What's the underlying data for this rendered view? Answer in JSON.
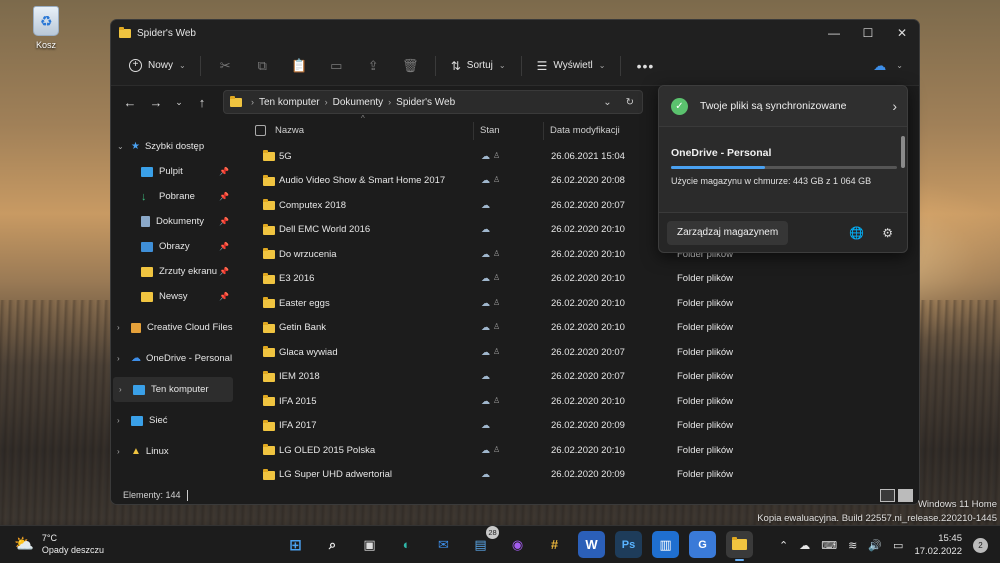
{
  "desktop": {
    "recycle_bin_label": "Kosz"
  },
  "window": {
    "title": "Spider's Web",
    "controls": {
      "minimize": "—",
      "maximize": "☐",
      "close": "✕"
    }
  },
  "toolbar": {
    "new_label": "Nowy",
    "sort_label": "Sortuj",
    "view_label": "Wyświetl",
    "more_label": "•••"
  },
  "address": {
    "crumbs": [
      "Ten komputer",
      "Dokumenty",
      "Spider's Web"
    ]
  },
  "sidebar": {
    "quick_access": "Szybki dostęp",
    "pinned": [
      "Pulpit",
      "Pobrane",
      "Dokumenty",
      "Obrazy",
      "Zrzuty ekranu",
      "Newsy"
    ],
    "creative_cloud": "Creative Cloud Files",
    "onedrive": "OneDrive - Personal",
    "this_pc": "Ten komputer",
    "network": "Sieć",
    "linux": "Linux"
  },
  "columns": {
    "name": "Nazwa",
    "status": "Stan",
    "date": "Data modyfikacji"
  },
  "files": [
    {
      "name": "5G",
      "date": "26.06.2021 15:04",
      "type": "",
      "shared": true
    },
    {
      "name": "Audio Video Show & Smart Home 2017",
      "date": "26.02.2020 20:08",
      "type": "",
      "shared": true
    },
    {
      "name": "Computex 2018",
      "date": "26.02.2020 20:07",
      "type": "",
      "shared": false
    },
    {
      "name": "Dell EMC World 2016",
      "date": "26.02.2020 20:10",
      "type": "",
      "shared": false
    },
    {
      "name": "Do wrzucenia",
      "date": "26.02.2020 20:10",
      "type": "Folder plików",
      "shared": true
    },
    {
      "name": "E3 2016",
      "date": "26.02.2020 20:10",
      "type": "Folder plików",
      "shared": true
    },
    {
      "name": "Easter eggs",
      "date": "26.02.2020 20:10",
      "type": "Folder plików",
      "shared": true
    },
    {
      "name": "Getin Bank",
      "date": "26.02.2020 20:10",
      "type": "Folder plików",
      "shared": true
    },
    {
      "name": "Glaca wywiad",
      "date": "26.02.2020 20:07",
      "type": "Folder plików",
      "shared": true
    },
    {
      "name": "IEM 2018",
      "date": "26.02.2020 20:07",
      "type": "Folder plików",
      "shared": false
    },
    {
      "name": "IFA 2015",
      "date": "26.02.2020 20:10",
      "type": "Folder plików",
      "shared": true
    },
    {
      "name": "IFA 2017",
      "date": "26.02.2020 20:09",
      "type": "Folder plików",
      "shared": false
    },
    {
      "name": "LG OLED 2015 Polska",
      "date": "26.02.2020 20:10",
      "type": "Folder plików",
      "shared": true
    },
    {
      "name": "LG Super UHD adwertorial",
      "date": "26.02.2020 20:09",
      "type": "Folder plików",
      "shared": false
    }
  ],
  "status": {
    "elements": "Elementy: 144"
  },
  "onedrive": {
    "sync_status": "Twoje pliki są synchronizowane",
    "account": "OneDrive - Personal",
    "usage": "Użycie magazynu w chmurze: 443 GB z 1 064 GB",
    "usage_fraction": 0.416,
    "manage_button": "Zarządzaj magazynem"
  },
  "watermark": {
    "line1": "Windows 11 Home",
    "line2": "Kopia ewaluacyjna. Build 22557.ni_release.220210-1445"
  },
  "taskbar": {
    "weather_temp": "7°C",
    "weather_desc": "Opady deszczu",
    "teams_badge": "28",
    "time": "15:45",
    "date": "17.02.2022",
    "notifications": "2"
  },
  "colors": {
    "accent": "#4aa1f0",
    "folder": "#f0c440",
    "sync_ok": "#5bc26e"
  }
}
